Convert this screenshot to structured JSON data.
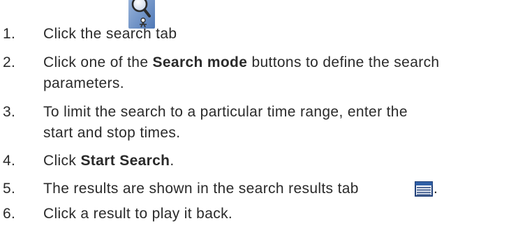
{
  "steps": [
    {
      "num": "1.",
      "text": "Click the search tab",
      "after": "."
    },
    {
      "num": "2.",
      "pre": "Click one of the ",
      "bold": "Search mode",
      "post": " buttons to define the search",
      "line2": "parameters."
    },
    {
      "num": "3.",
      "text": "To limit the search to a particular time range, enter the",
      "line2": "start and stop times."
    },
    {
      "num": "4.",
      "pre": "Click ",
      "bold": "Start Search",
      "post": "."
    },
    {
      "num": "5.",
      "text": "The results are shown in the search results tab",
      "after": "."
    },
    {
      "num": "6.",
      "text": "Click a result to play it back."
    }
  ],
  "icons": {
    "search_tab": "search-tab-magnifier-icon",
    "results_tab": "search-results-list-icon"
  },
  "colors": {
    "text": "#2a2a2a",
    "icon_blue": "#2f5fa6"
  }
}
